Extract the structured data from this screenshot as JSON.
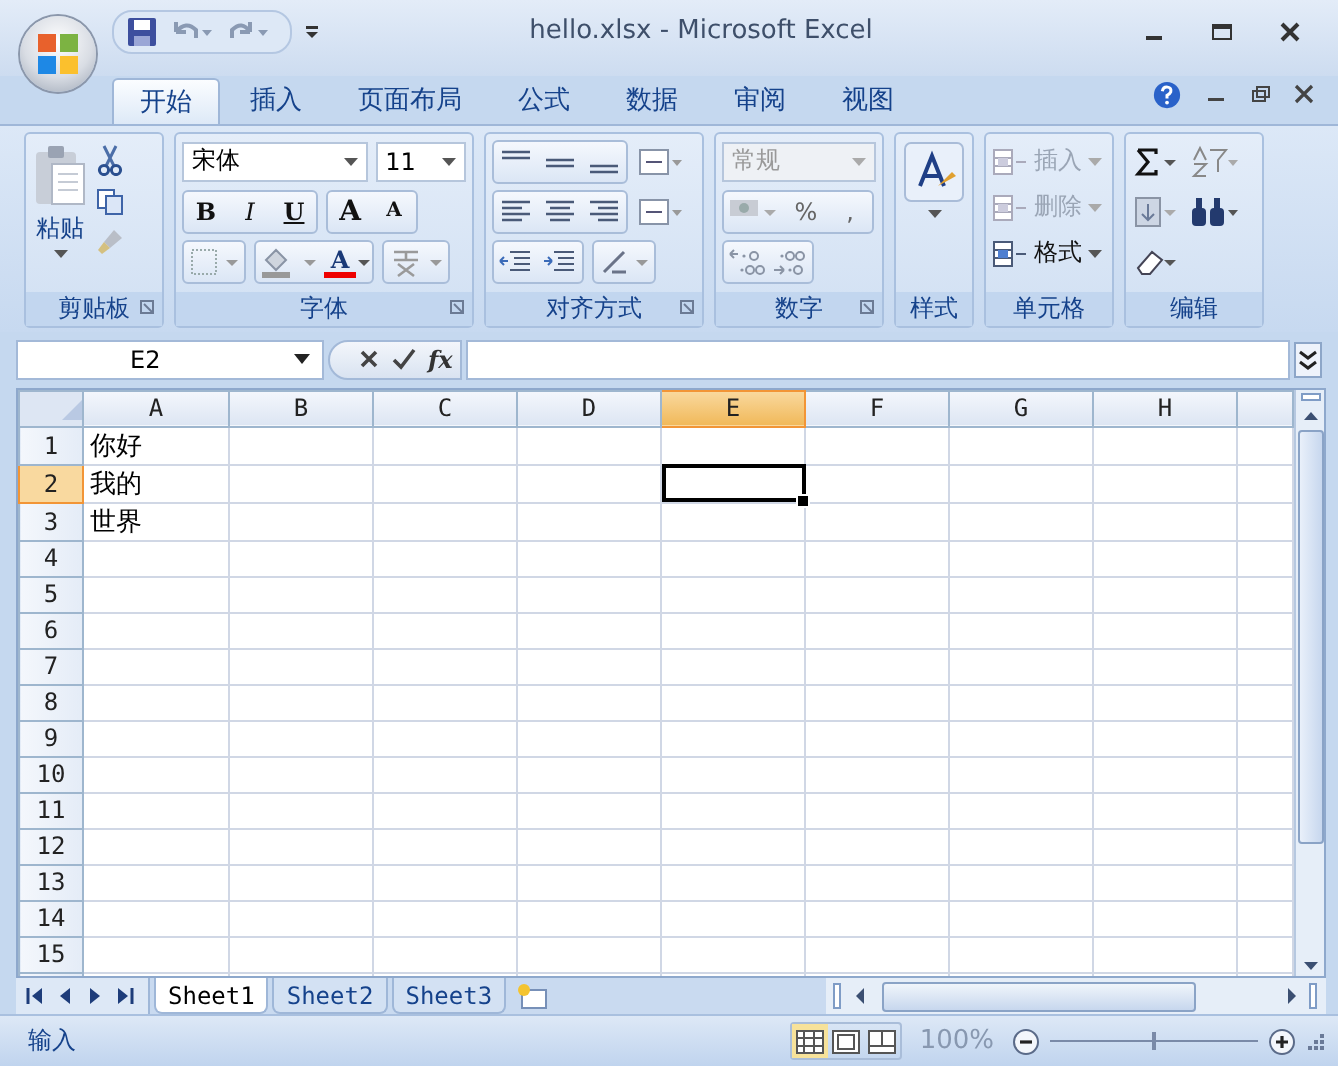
{
  "window": {
    "title": "hello.xlsx - Microsoft Excel"
  },
  "tabs": [
    {
      "label": "开始",
      "selected": true
    },
    {
      "label": "插入",
      "selected": false
    },
    {
      "label": "页面布局",
      "selected": false
    },
    {
      "label": "公式",
      "selected": false
    },
    {
      "label": "数据",
      "selected": false
    },
    {
      "label": "审阅",
      "selected": false
    },
    {
      "label": "视图",
      "selected": false
    }
  ],
  "ribbon": {
    "clipboard": {
      "label": "剪贴板",
      "paste": "粘贴"
    },
    "font": {
      "label": "字体",
      "font_name": "宋体",
      "font_size": "11",
      "style_buttons": [
        "B",
        "I",
        "U"
      ],
      "size_buttons": [
        "A",
        "A"
      ],
      "color_button": "A"
    },
    "alignment": {
      "label": "对齐方式"
    },
    "number": {
      "label": "数字",
      "format": {
        "value": "常规",
        "disabled": true
      },
      "buttons": [
        "%",
        ","
      ]
    },
    "styles": {
      "label": "样式"
    },
    "cells": {
      "label": "单元格",
      "items": [
        {
          "label": "插入",
          "disabled": true
        },
        {
          "label": "删除",
          "disabled": true
        },
        {
          "label": "格式",
          "disabled": false
        }
      ]
    },
    "editing": {
      "label": "编辑"
    }
  },
  "formula_bar": {
    "name_box": "E2",
    "function_label": "fx"
  },
  "sheet": {
    "columns": [
      {
        "label": "A",
        "selected": false
      },
      {
        "label": "B",
        "selected": false
      },
      {
        "label": "C",
        "selected": false
      },
      {
        "label": "D",
        "selected": false
      },
      {
        "label": "E",
        "selected": true
      },
      {
        "label": "F",
        "selected": false
      },
      {
        "label": "G",
        "selected": false
      },
      {
        "label": "H",
        "selected": false
      }
    ],
    "rows": [
      {
        "number": "1",
        "selected": false,
        "cells": [
          "你好"
        ]
      },
      {
        "number": "2",
        "selected": true,
        "cells": [
          "我的"
        ]
      },
      {
        "number": "3",
        "selected": false,
        "cells": [
          "世界"
        ]
      },
      {
        "number": "4",
        "selected": false,
        "cells": []
      },
      {
        "number": "5",
        "selected": false,
        "cells": []
      },
      {
        "number": "6",
        "selected": false,
        "cells": []
      },
      {
        "number": "7",
        "selected": false,
        "cells": []
      },
      {
        "number": "8",
        "selected": false,
        "cells": []
      },
      {
        "number": "9",
        "selected": false,
        "cells": []
      },
      {
        "number": "10",
        "selected": false,
        "cells": []
      },
      {
        "number": "11",
        "selected": false,
        "cells": []
      },
      {
        "number": "12",
        "selected": false,
        "cells": []
      },
      {
        "number": "13",
        "selected": false,
        "cells": []
      },
      {
        "number": "14",
        "selected": false,
        "cells": []
      },
      {
        "number": "15",
        "selected": false,
        "cells": []
      }
    ]
  },
  "sheet_tabs": [
    {
      "label": "Sheet1",
      "selected": true
    },
    {
      "label": "Sheet2",
      "selected": false
    },
    {
      "label": "Sheet3",
      "selected": false
    }
  ],
  "status_bar": {
    "mode": "输入",
    "view_buttons": [
      {
        "selected": true
      },
      {
        "selected": false
      },
      {
        "selected": false
      }
    ],
    "zoom": "100%",
    "zoom_slider": {
      "level": 0.5
    }
  }
}
